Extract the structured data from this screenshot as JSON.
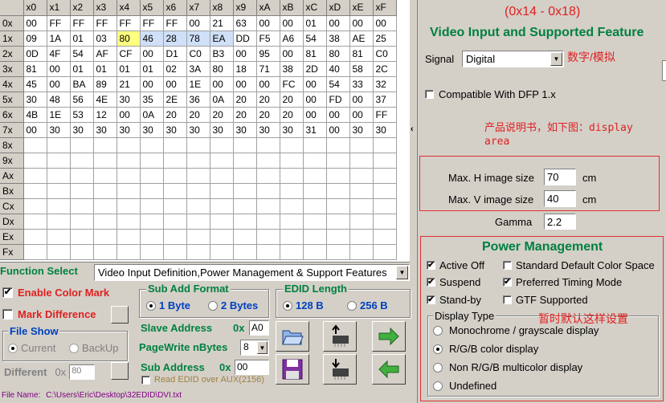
{
  "grid": {
    "col_headers": [
      "x0",
      "x1",
      "x2",
      "x3",
      "x4",
      "x5",
      "x6",
      "x7",
      "x8",
      "x9",
      "xA",
      "xB",
      "xC",
      "xD",
      "xE",
      "xF"
    ],
    "row_headers": [
      "0x",
      "1x",
      "2x",
      "3x",
      "4x",
      "5x",
      "6x",
      "7x",
      "8x",
      "9x",
      "Ax",
      "Bx",
      "Cx",
      "Dx",
      "Ex",
      "Fx"
    ],
    "rows": [
      [
        "00",
        "FF",
        "FF",
        "FF",
        "FF",
        "FF",
        "FF",
        "00",
        "21",
        "63",
        "00",
        "00",
        "01",
        "00",
        "00",
        "00"
      ],
      [
        "09",
        "1A",
        "01",
        "03",
        "80",
        "46",
        "28",
        "78",
        "EA",
        "DD",
        "F5",
        "A6",
        "54",
        "38",
        "AE",
        "25"
      ],
      [
        "0D",
        "4F",
        "54",
        "AF",
        "CF",
        "00",
        "D1",
        "C0",
        "B3",
        "00",
        "95",
        "00",
        "81",
        "80",
        "81",
        "C0"
      ],
      [
        "81",
        "00",
        "01",
        "01",
        "01",
        "01",
        "02",
        "3A",
        "80",
        "18",
        "71",
        "38",
        "2D",
        "40",
        "58",
        "2C"
      ],
      [
        "45",
        "00",
        "BA",
        "89",
        "21",
        "00",
        "00",
        "1E",
        "00",
        "00",
        "00",
        "FC",
        "00",
        "54",
        "33",
        "32"
      ],
      [
        "30",
        "48",
        "56",
        "4E",
        "30",
        "35",
        "2E",
        "36",
        "0A",
        "20",
        "20",
        "20",
        "00",
        "FD",
        "00",
        "37"
      ],
      [
        "4B",
        "1E",
        "53",
        "12",
        "00",
        "0A",
        "20",
        "20",
        "20",
        "20",
        "20",
        "20",
        "00",
        "00",
        "00",
        "FF"
      ],
      [
        "00",
        "30",
        "30",
        "30",
        "30",
        "30",
        "30",
        "30",
        "30",
        "30",
        "30",
        "30",
        "31",
        "00",
        "30",
        "30"
      ],
      [],
      [],
      [],
      [],
      [],
      [],
      [],
      []
    ],
    "selected": {
      "row": 1,
      "col": 4
    },
    "highlight_cols": [
      5,
      6,
      7,
      8
    ],
    "highlight_row": 1
  },
  "function_select": {
    "label": "Function Select",
    "value": "Video Input Definition,Power Management & Support Features"
  },
  "enable_color_mark": {
    "label": "Enable Color Mark",
    "checked": true
  },
  "mark_difference": {
    "label": "Mark Difference",
    "checked": false
  },
  "file_show": {
    "title": "File Show",
    "current": "Current",
    "backup": "BackUp"
  },
  "different": {
    "label": "Different",
    "prefix": "0x",
    "value": "80"
  },
  "sub_add_format": {
    "title": "Sub Add Format",
    "opt1": "1 Byte",
    "opt2": "2 Bytes"
  },
  "edid_length": {
    "title": "EDID Length",
    "opt1": "128 B",
    "opt2": "256 B"
  },
  "slave_address": {
    "label": "Slave Address",
    "prefix": "0x",
    "value": "A0"
  },
  "pagewrite": {
    "label": "PageWrite nBytes",
    "value": "8"
  },
  "sub_address": {
    "label": "Sub Address",
    "prefix": "0x",
    "value": "00"
  },
  "read_aux": {
    "label": "Read EDID over AUX(2156)"
  },
  "file_name": {
    "label": "File Name:",
    "path": "C:\\Users\\Eric\\Desktop\\32EDID\\DVI.txt"
  },
  "right": {
    "range": "(0x14 - 0x18)",
    "title": "Video Input and Supported Feature",
    "signal_label": "Signal",
    "signal_value": "Digital",
    "note_signal": "数字/模拟",
    "dfp_label": "Compatible With DFP 1.x",
    "note_manual": "产品说明书，如下图：display area",
    "maxh_label": "Max. H image size",
    "maxh_value": "70",
    "maxv_label": "Max. V image size",
    "maxv_value": "40",
    "unit": "cm",
    "gamma_label": "Gamma",
    "gamma_value": "2.2",
    "pm_title": "Power Management",
    "active_off": "Active Off",
    "suspend": "Suspend",
    "standby": "Stand-by",
    "std_color": "Standard Default Color Space",
    "pref_timing": "Preferred Timing Mode",
    "gtf": "GTF Supported",
    "display_type": "Display Type",
    "note_default": "暂时默认这样设置",
    "dt_opts": [
      "Monochrome / grayscale display",
      "R/G/B color display",
      "Non R/G/B  multicolor display",
      "Undefined"
    ]
  },
  "colors": {
    "accent_green": "#008040",
    "title_red": "#e02020",
    "blue_label": "#0040c0"
  },
  "icons": [
    "open-folder-icon",
    "read-chip-icon",
    "forward-arrow-icon",
    "save-disk-icon",
    "write-chip-icon",
    "back-arrow-icon"
  ]
}
